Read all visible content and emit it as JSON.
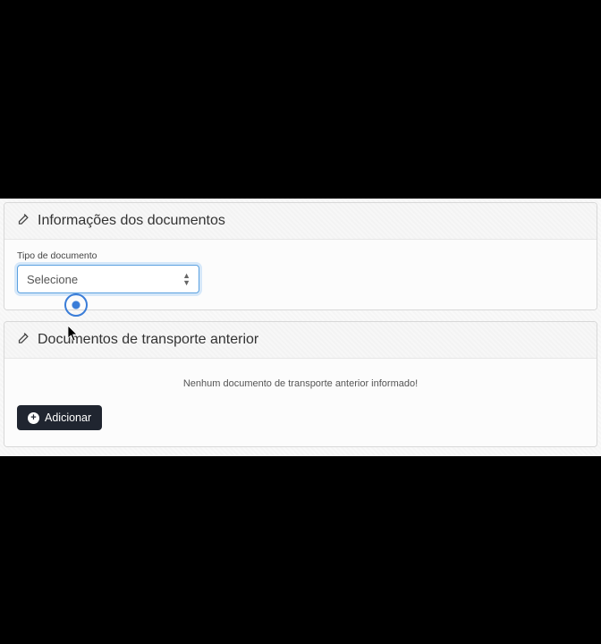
{
  "panels": {
    "docs": {
      "title": "Informações dos documentos",
      "field_label": "Tipo de documento",
      "select_value": "Selecione"
    },
    "prev": {
      "title": "Documentos de transporte anterior",
      "empty": "Nenhum documento de transporte anterior informado!",
      "add_label": "Adicionar"
    }
  }
}
